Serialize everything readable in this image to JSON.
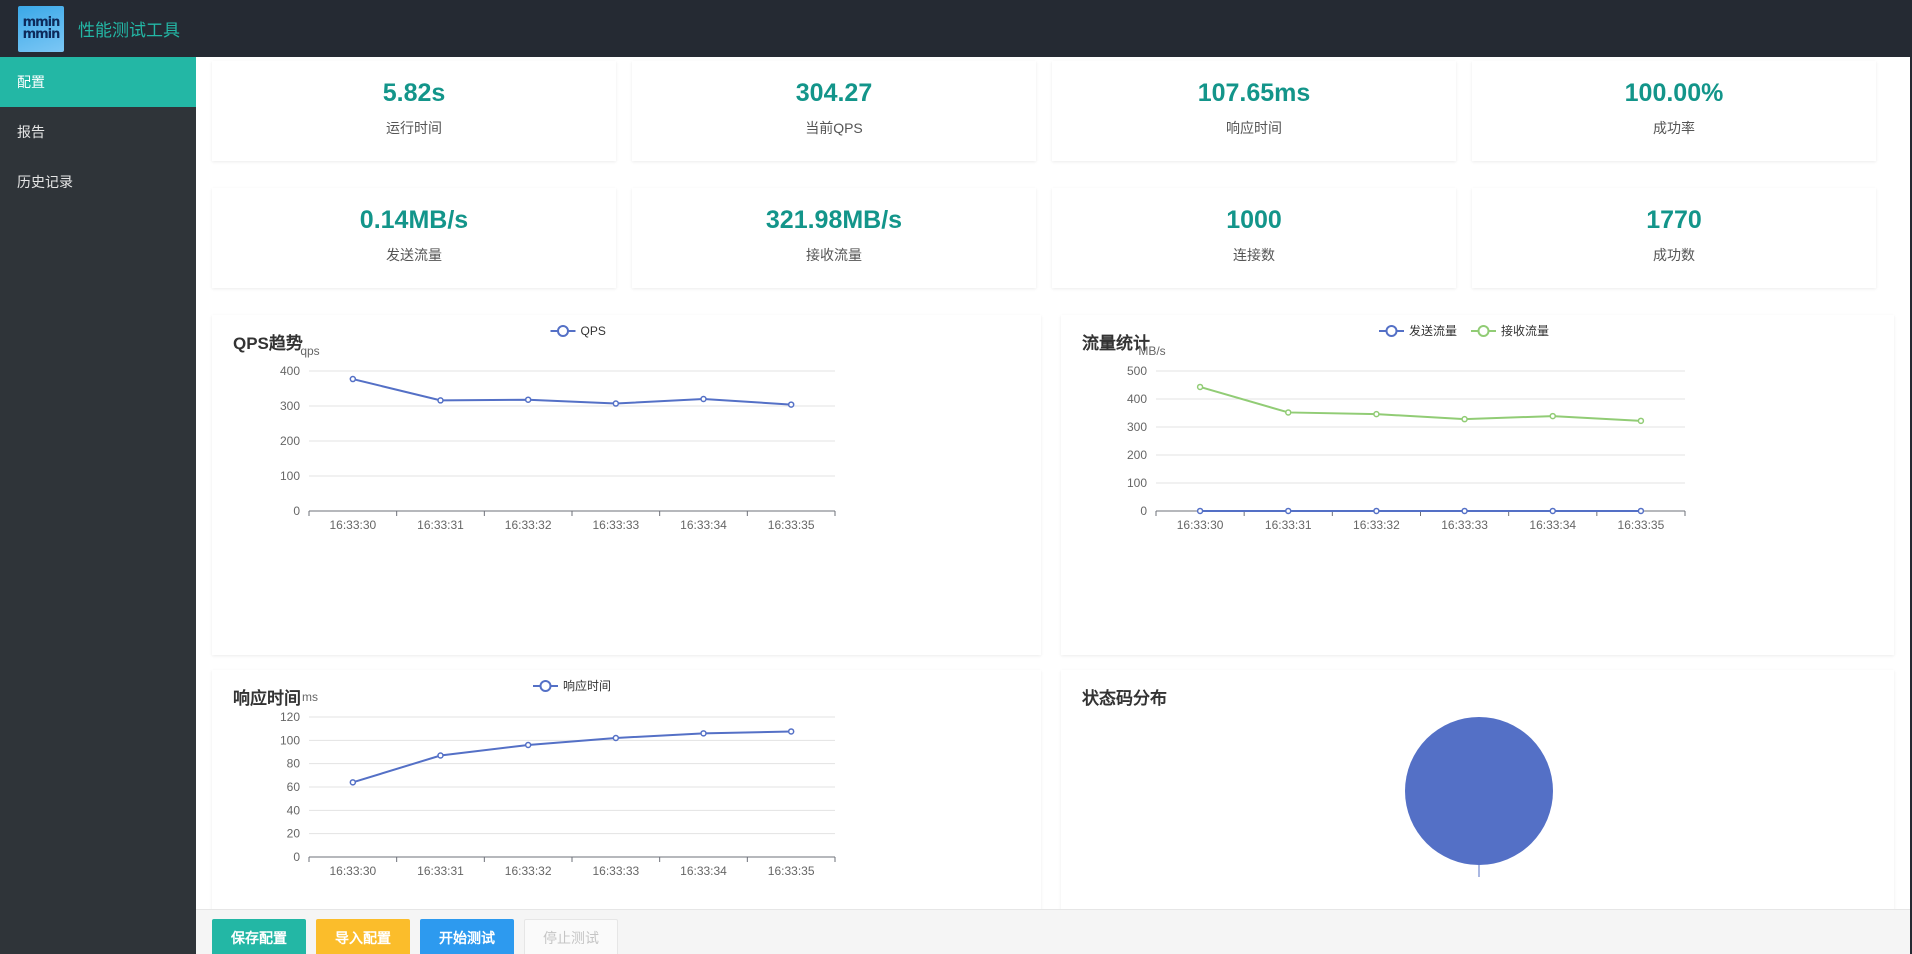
{
  "app": {
    "logo_text": "mmin",
    "title": "性能测试工具"
  },
  "sidebar": {
    "items": [
      {
        "label": "配置"
      },
      {
        "label": "报告"
      },
      {
        "label": "历史记录"
      }
    ]
  },
  "stats": [
    {
      "value": "5.82s",
      "label": "运行时间"
    },
    {
      "value": "304.27",
      "label": "当前QPS"
    },
    {
      "value": "107.65ms",
      "label": "响应时间"
    },
    {
      "value": "100.00%",
      "label": "成功率"
    },
    {
      "value": "0.14MB/s",
      "label": "发送流量"
    },
    {
      "value": "321.98MB/s",
      "label": "接收流量"
    },
    {
      "value": "1000",
      "label": "连接数"
    },
    {
      "value": "1770",
      "label": "成功数"
    }
  ],
  "colors": {
    "accent": "#23b7a5",
    "stat_value": "#13958a",
    "series_blue": "#5470c6",
    "series_green": "#91cc75",
    "import_button": "#fbbd2b",
    "start_button": "#2d9aef"
  },
  "chart_data": [
    {
      "title": "QPS趋势",
      "type": "line",
      "ylabel": "qps",
      "categories": [
        "16:33:30",
        "16:33:31",
        "16:33:32",
        "16:33:33",
        "16:33:34",
        "16:33:35"
      ],
      "ylim": [
        0,
        400
      ],
      "yticks": [
        0,
        100,
        200,
        300,
        400
      ],
      "series": [
        {
          "name": "QPS",
          "values": [
            377,
            316,
            318,
            307,
            320,
            304
          ],
          "color": "#5470c6"
        }
      ],
      "grid": true,
      "legend": "top-center"
    },
    {
      "title": "流量统计",
      "type": "line",
      "ylabel": "MB/s",
      "categories": [
        "16:33:30",
        "16:33:31",
        "16:33:32",
        "16:33:33",
        "16:33:34",
        "16:33:35"
      ],
      "ylim": [
        0,
        500
      ],
      "yticks": [
        0,
        100,
        200,
        300,
        400,
        500
      ],
      "series": [
        {
          "name": "发送流量",
          "values": [
            0.14,
            0.14,
            0.14,
            0.14,
            0.14,
            0.14
          ],
          "color": "#5470c6"
        },
        {
          "name": "接收流量",
          "values": [
            443,
            352,
            346,
            328,
            339,
            322
          ],
          "color": "#91cc75"
        }
      ],
      "grid": true,
      "legend": "top-center"
    },
    {
      "title": "响应时间",
      "type": "line",
      "ylabel": "ms",
      "categories": [
        "16:33:30",
        "16:33:31",
        "16:33:32",
        "16:33:33",
        "16:33:34",
        "16:33:35"
      ],
      "ylim": [
        0,
        120
      ],
      "yticks": [
        0,
        20,
        40,
        60,
        80,
        100,
        120
      ],
      "series": [
        {
          "name": "响应时间",
          "values": [
            64,
            87,
            96,
            102,
            106,
            107.6
          ],
          "color": "#5470c6"
        }
      ],
      "grid": true,
      "legend": "top-center"
    },
    {
      "title": "状态码分布",
      "type": "pie",
      "series": [
        {
          "values": [
            100
          ],
          "color": "#5470c6"
        }
      ]
    }
  ],
  "footer": {
    "save": "保存配置",
    "import": "导入配置",
    "start": "开始测试",
    "stop": "停止测试"
  }
}
